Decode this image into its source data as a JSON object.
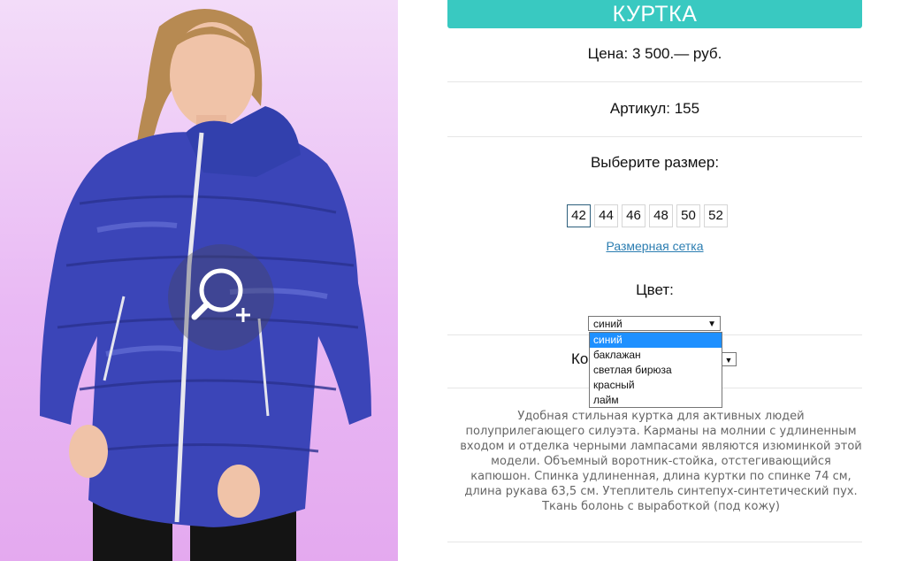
{
  "product": {
    "title": "КУРТКА",
    "price": "Цена: 3 500.— руб.",
    "article": "Артикул: 155",
    "size_prompt": "Выберите размер:",
    "sizes": [
      "42",
      "44",
      "46",
      "48",
      "50",
      "52"
    ],
    "selected_size": "42",
    "size_chart_link": "Размерная сетка",
    "color_label": "Цвет:",
    "color_selected": "синий",
    "color_options": [
      "синий",
      "баклажан",
      "светлая бирюза",
      "красный",
      "лайм"
    ],
    "quantity_label_visible": "Ко",
    "description": "Удобная стильная куртка для активных людей полуприлегающего силуэта. Карманы на молнии с удлиненным входом и отделка черными лампасами являются изюминкой этой модели. Объемный воротник-стойка, отстегивающийся капюшон. Спинка удлиненная, длина куртки по спинке 74 см, длина рукава 63,5 см. Утеплитель синтепух-синтетический пух. Ткань болонь с выработкой (под кожу)"
  },
  "colors": {
    "accent": "#39c9c1",
    "link": "#2b7db1",
    "jacket": "#3b45b8",
    "dropdown_highlight": "#1e90ff"
  },
  "icons": {
    "zoom": "magnifier-plus-icon"
  }
}
